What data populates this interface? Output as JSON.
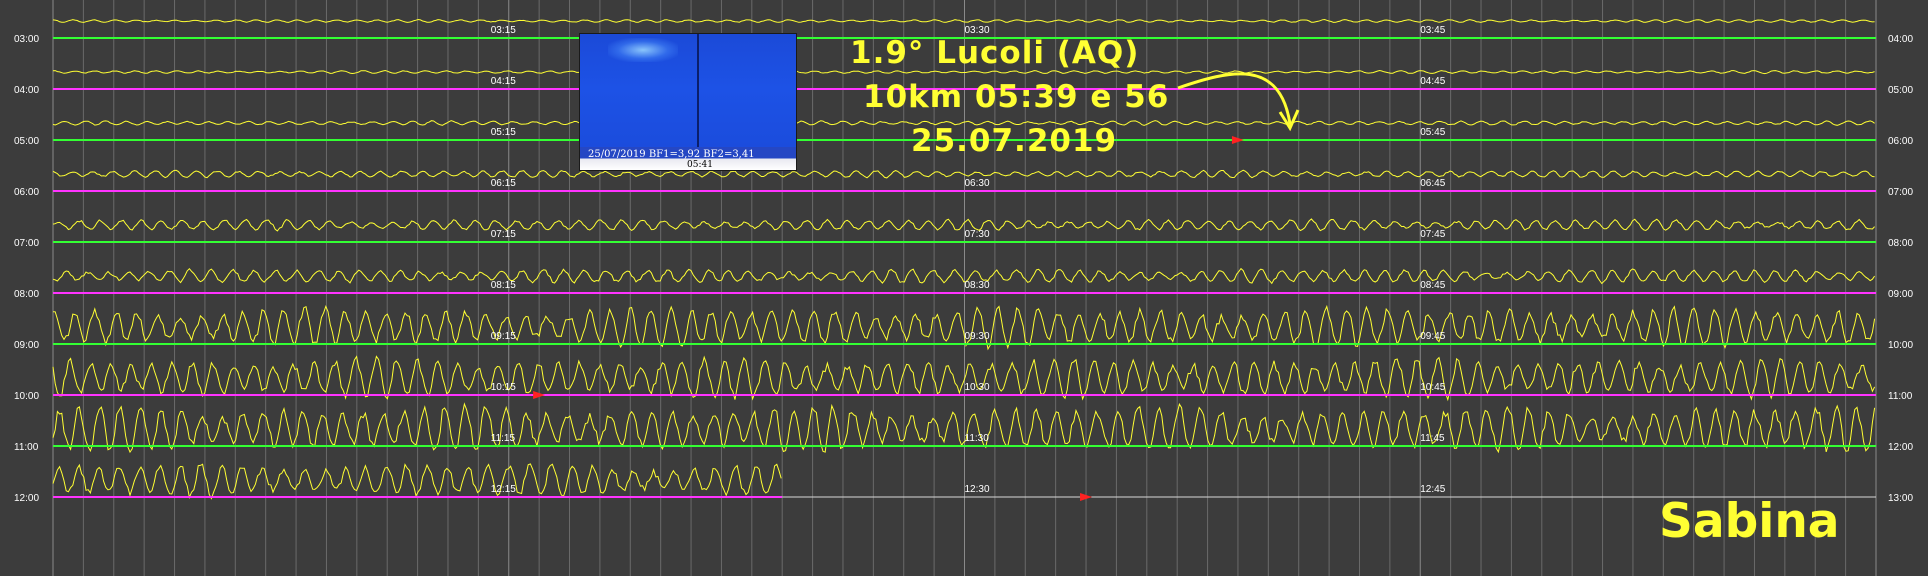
{
  "chart_data": {
    "type": "line",
    "kind": "helicorder",
    "station": "Sabina",
    "annotation": {
      "line1": "1.9°  Lucoli (AQ)",
      "line2": "10km 05:39 e 56",
      "line3": "25.07.2019",
      "arrow_target_time": "05:39"
    },
    "inset": {
      "caption": "25/07/2019 BF1=3,92 BF2=3,41",
      "time": "05:41"
    },
    "left_labels": [
      "03:00",
      "04:00",
      "05:00",
      "06:00",
      "07:00",
      "08:00",
      "09:00",
      "10:00",
      "11:00",
      "12:00"
    ],
    "right_labels": [
      "04:00",
      "05:00",
      "06:00",
      "07:00",
      "08:00",
      "09:00",
      "10:00",
      "11:00",
      "12:00",
      "13:00"
    ],
    "row_labels": [
      [
        "03:15",
        "03:30",
        "03:45"
      ],
      [
        "04:15",
        "",
        "04:45"
      ],
      [
        "05:15",
        "",
        "05:45"
      ],
      [
        "06:15",
        "06:30",
        "06:45"
      ],
      [
        "07:15",
        "07:30",
        "07:45"
      ],
      [
        "08:15",
        "08:30",
        "08:45"
      ],
      [
        "09:15",
        "09:30",
        "09:45"
      ],
      [
        "10:15",
        "10:30",
        "10:45"
      ],
      [
        "11:15",
        "11:30",
        "11:45"
      ],
      [
        "12:15",
        "12:30",
        "12:45"
      ]
    ],
    "trace_colors": [
      "#33ff33",
      "#ff33ff"
    ],
    "noise_color": "#ffff33",
    "amplitude_by_row": [
      1,
      1,
      1.5,
      2.5,
      4,
      5,
      14,
      14,
      16,
      12
    ],
    "event_markers": [
      {
        "row": 2,
        "minute": 39,
        "color": "#ff2222"
      },
      {
        "row": 7,
        "minute": 16,
        "color": "#ff2222"
      },
      {
        "row": 9,
        "minute": 34,
        "color": "#ff2222"
      }
    ],
    "last_row_end_minute": 24,
    "grid": true
  }
}
